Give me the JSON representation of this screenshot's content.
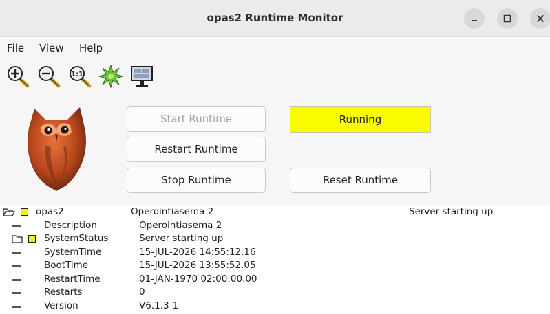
{
  "window": {
    "title": "opas2 Runtime Monitor",
    "controls": [
      "minimize-icon",
      "maximize-icon",
      "close-icon"
    ]
  },
  "menu": {
    "file": "File",
    "view": "View",
    "help": "Help"
  },
  "toolbar": {
    "tools": [
      "zoom-in-icon",
      "zoom-out-icon",
      "zoom-reset-icon",
      "star-burst-icon",
      "monitor-icon"
    ]
  },
  "controls": {
    "start": "Start Runtime",
    "restart": "Restart Runtime",
    "stop": "Stop Runtime",
    "reset": "Reset Runtime",
    "status": "Running",
    "status_color": "#fafa00"
  },
  "tree": {
    "root": {
      "name": "opas2",
      "value": "Operointiasema 2",
      "status": "Server starting up"
    },
    "children": [
      {
        "name": "Description",
        "value": "Operointiasema 2"
      },
      {
        "name": "SystemStatus",
        "value": "Server starting up"
      },
      {
        "name": "SystemTime",
        "value": "15-JUL-2026 14:55:12.16"
      },
      {
        "name": "BootTime",
        "value": "15-JUL-2026 13:55:52.05"
      },
      {
        "name": "RestartTime",
        "value": "01-JAN-1970 02:00:00.00"
      },
      {
        "name": "Restarts",
        "value": "0"
      },
      {
        "name": "Version",
        "value": "V6.1.3-1"
      }
    ]
  }
}
